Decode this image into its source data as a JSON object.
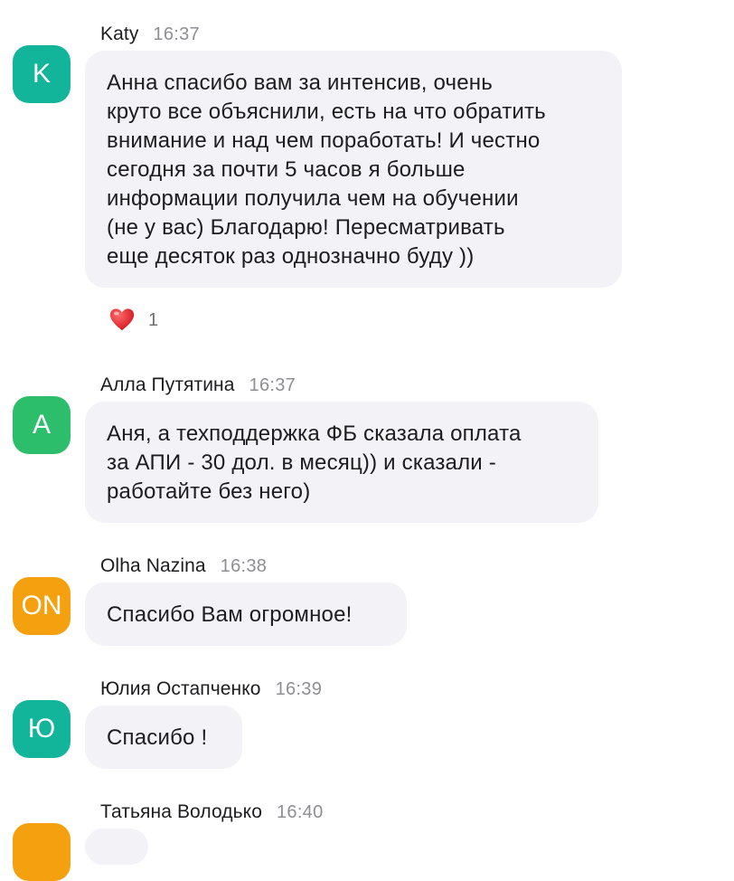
{
  "colors": {
    "bubble_bg": "#f2f2f7",
    "time_text": "#8e8e93",
    "avatar_teal": "#12b59a",
    "avatar_green": "#2cbe6b",
    "avatar_orange": "#f5a00f",
    "heart_red": "#e0242e"
  },
  "messages": [
    {
      "author": "Katy",
      "time": "16:37",
      "avatar_initials": "K",
      "avatar_color": "#12b59a",
      "text_lines": [
        "Анна спасибо вам за интенсив, очень",
        "круто все объяснили, есть на что обратить",
        "внимание и над чем поработать! И честно",
        "сегодня за почти 5 часов я больше",
        "информации получила чем на обучении",
        "(не у вас) Благодарю! Пересматривать",
        "еще десяток раз однозначно буду ))"
      ],
      "reaction": {
        "icon": "heart-icon",
        "count": "1"
      }
    },
    {
      "author": "Алла Путятина",
      "time": "16:37",
      "avatar_initials": "А",
      "avatar_color": "#2cbe6b",
      "text_lines": [
        "Аня, а техподдержка ФБ сказала оплата",
        "за АПИ - 30 дол. в месяц)) и сказали -",
        "работайте без него)"
      ]
    },
    {
      "author": "Olha Nazina",
      "time": "16:38",
      "avatar_initials": "ON",
      "avatar_color": "#f5a00f",
      "text_lines": [
        "Спасибо Вам огромное!"
      ]
    },
    {
      "author": "Юлия Остапченко",
      "time": "16:39",
      "avatar_initials": "Ю",
      "avatar_color": "#12b59a",
      "text_lines": [
        "Спасибо !"
      ]
    },
    {
      "author": "Татьяна Володько",
      "time": "16:40",
      "avatar_color": "#f5a00f"
    }
  ]
}
